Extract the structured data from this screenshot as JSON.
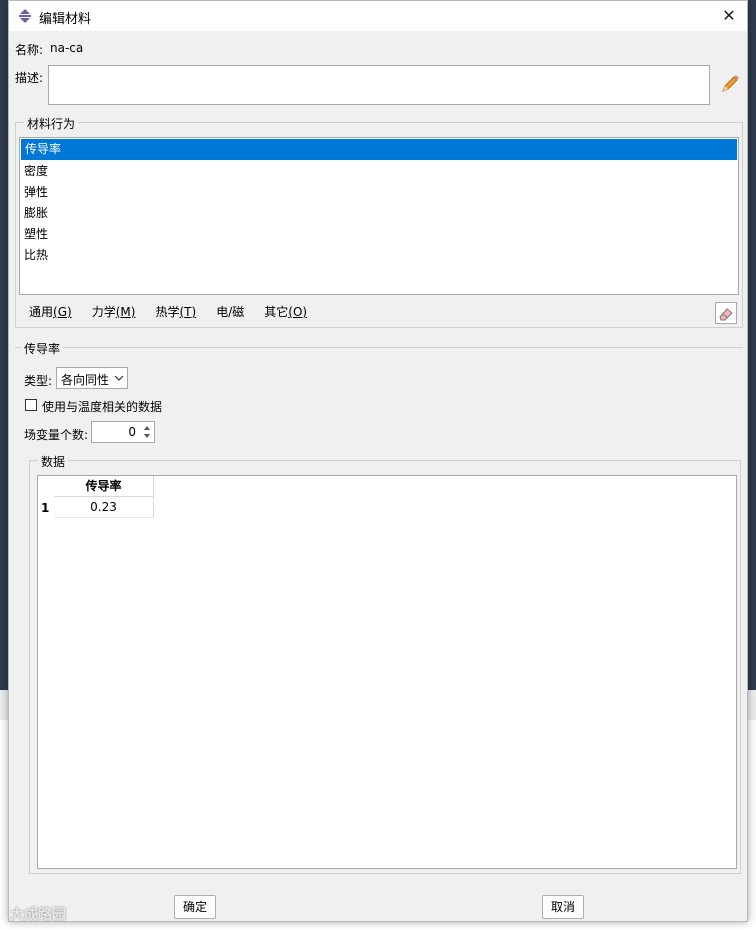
{
  "window": {
    "title": "编辑材料",
    "close_glyph": "✕"
  },
  "name": {
    "label": "名称:",
    "value": "na-ca"
  },
  "description": {
    "label": "描述:",
    "value": ""
  },
  "behaviors": {
    "group_title": "材料行为",
    "items": [
      "传导率",
      "密度",
      "弹性",
      "膨胀",
      "塑性",
      "比热"
    ],
    "selected_index": 0
  },
  "menu": {
    "items": [
      {
        "label": "通用",
        "mnemonic": "G"
      },
      {
        "label": "力学",
        "mnemonic": "M"
      },
      {
        "label": "热学",
        "mnemonic": "T"
      },
      {
        "label": "电/磁",
        "mnemonic": ""
      },
      {
        "label": "其它",
        "mnemonic": "O"
      }
    ]
  },
  "conductivity": {
    "group_title": "传导率",
    "type_label": "类型:",
    "type_value": "各向同性",
    "temp_dependent_label": "使用与温度相关的数据",
    "temp_dependent_checked": false,
    "field_vars_label": "场变量个数:",
    "field_vars_value": "0"
  },
  "data": {
    "group_title": "数据",
    "columns": [
      "传导率"
    ],
    "rows": [
      {
        "index": "1",
        "values": [
          "0.23"
        ]
      }
    ]
  },
  "buttons": {
    "ok": "确定",
    "cancel": "取消"
  },
  "watermark": "大成路园",
  "colors": {
    "selection": "#0078d7",
    "dialog_bg": "#f0f0f0"
  }
}
